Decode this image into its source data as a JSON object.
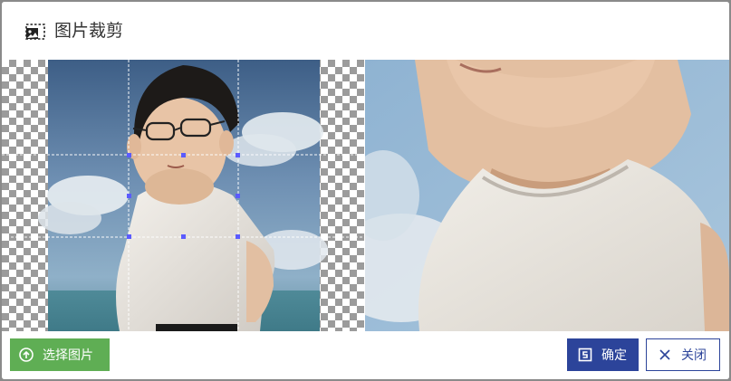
{
  "dialog": {
    "title": "图片裁剪",
    "title_icon": "image-crop-icon"
  },
  "footer": {
    "select_label": "选择图片",
    "select_icon": "upload-circle-icon",
    "confirm_label": "确定",
    "confirm_icon": "save-icon",
    "close_label": "关闭",
    "close_icon": "close-icon"
  },
  "colors": {
    "select_button": "#5fae54",
    "confirm_button": "#2c449a",
    "close_border": "#2c449a",
    "crop_handle": "#5b5bff"
  }
}
